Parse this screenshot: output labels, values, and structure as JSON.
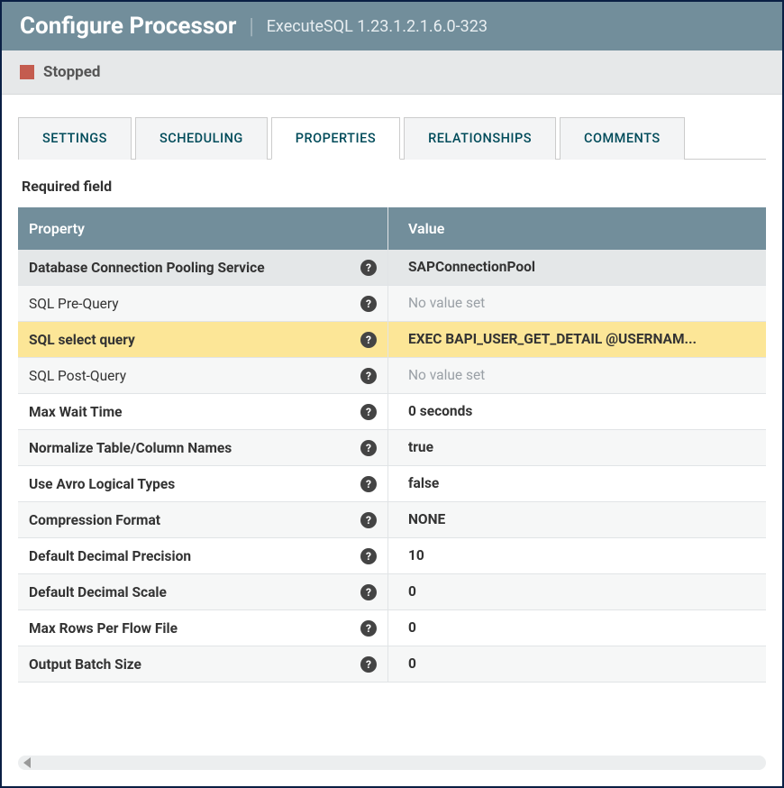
{
  "header": {
    "title": "Configure Processor",
    "subtitle": "ExecuteSQL 1.23.1.2.1.6.0-323"
  },
  "status": {
    "label": "Stopped"
  },
  "tabs": [
    {
      "label": "SETTINGS",
      "active": false
    },
    {
      "label": "SCHEDULING",
      "active": false
    },
    {
      "label": "PROPERTIES",
      "active": true
    },
    {
      "label": "RELATIONSHIPS",
      "active": false
    },
    {
      "label": "COMMENTS",
      "active": false
    }
  ],
  "table": {
    "requiredLabel": "Required field",
    "headers": {
      "property": "Property",
      "value": "Value"
    },
    "rows": [
      {
        "name": "Database Connection Pooling Service",
        "value": "SAPConnectionPool",
        "bold": true,
        "required": true,
        "novalue": false,
        "highlight": false
      },
      {
        "name": "SQL Pre-Query",
        "value": "No value set",
        "bold": false,
        "required": false,
        "novalue": true,
        "highlight": false
      },
      {
        "name": "SQL select query",
        "value": "EXEC BAPI_USER_GET_DETAIL @USERNAM...",
        "bold": true,
        "required": false,
        "novalue": false,
        "highlight": true
      },
      {
        "name": "SQL Post-Query",
        "value": "No value set",
        "bold": false,
        "required": false,
        "novalue": true,
        "highlight": false
      },
      {
        "name": "Max Wait Time",
        "value": "0 seconds",
        "bold": true,
        "required": false,
        "novalue": false,
        "highlight": false
      },
      {
        "name": "Normalize Table/Column Names",
        "value": "true",
        "bold": true,
        "required": false,
        "novalue": false,
        "highlight": false
      },
      {
        "name": "Use Avro Logical Types",
        "value": "false",
        "bold": true,
        "required": false,
        "novalue": false,
        "highlight": false
      },
      {
        "name": "Compression Format",
        "value": "NONE",
        "bold": true,
        "required": false,
        "novalue": false,
        "highlight": false
      },
      {
        "name": "Default Decimal Precision",
        "value": "10",
        "bold": true,
        "required": false,
        "novalue": false,
        "highlight": false
      },
      {
        "name": "Default Decimal Scale",
        "value": "0",
        "bold": true,
        "required": false,
        "novalue": false,
        "highlight": false
      },
      {
        "name": "Max Rows Per Flow File",
        "value": "0",
        "bold": true,
        "required": false,
        "novalue": false,
        "highlight": false
      },
      {
        "name": "Output Batch Size",
        "value": "0",
        "bold": true,
        "required": false,
        "novalue": false,
        "highlight": false
      }
    ]
  }
}
